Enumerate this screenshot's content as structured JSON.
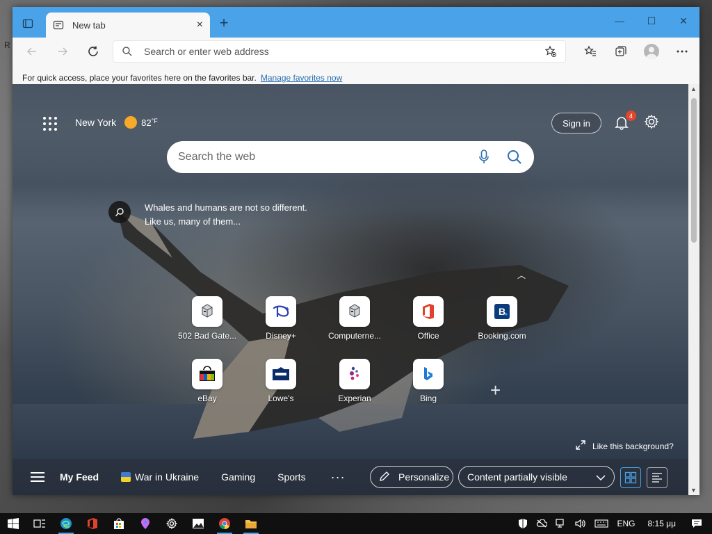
{
  "browser": {
    "tab": {
      "title": "New tab",
      "close": "×"
    },
    "new_tab": "+",
    "window_controls": {
      "minimize": "—",
      "maximize": "☐",
      "close": "✕"
    },
    "address": {
      "placeholder": "Search or enter web address"
    },
    "favorites_bar": {
      "text": "For quick access, place your favorites here on the favorites bar.",
      "link": "Manage favorites now"
    }
  },
  "desktop": {
    "edge_glyph": "R"
  },
  "newtab": {
    "weather": {
      "city": "New York",
      "temp": "82",
      "unit": "°F"
    },
    "sign_in": "Sign in",
    "notifications": {
      "count": "4"
    },
    "search": {
      "placeholder": "Search the web"
    },
    "fact": {
      "line1": "Whales and humans are not so different.",
      "line2": "Like us, many of them..."
    },
    "tiles": [
      {
        "label": "502 Bad Gate...",
        "icon": "server-icon"
      },
      {
        "label": "Disney+",
        "icon": "disney-icon"
      },
      {
        "label": "Computerne...",
        "icon": "server-icon"
      },
      {
        "label": "Office",
        "icon": "office-icon"
      },
      {
        "label": "Booking.com",
        "icon": "booking-icon"
      },
      {
        "label": "eBay",
        "icon": "ebay-icon"
      },
      {
        "label": "Lowe's",
        "icon": "lowes-icon"
      },
      {
        "label": "Experian",
        "icon": "experian-icon"
      },
      {
        "label": "Bing",
        "icon": "bing-icon"
      }
    ],
    "add_tile": "+",
    "like_background": "Like this background?",
    "feed": {
      "items": [
        "My Feed",
        "War in Ukraine",
        "Gaming",
        "Sports"
      ],
      "more": "···",
      "personalize": "Personalize",
      "content_visibility": "Content partially visible"
    }
  },
  "taskbar": {
    "language": "ENG",
    "time": "8:15 μμ"
  },
  "colors": {
    "titlebar": "#4aa3e8",
    "accent": "#4aa3e8",
    "badge": "#e0472b"
  }
}
